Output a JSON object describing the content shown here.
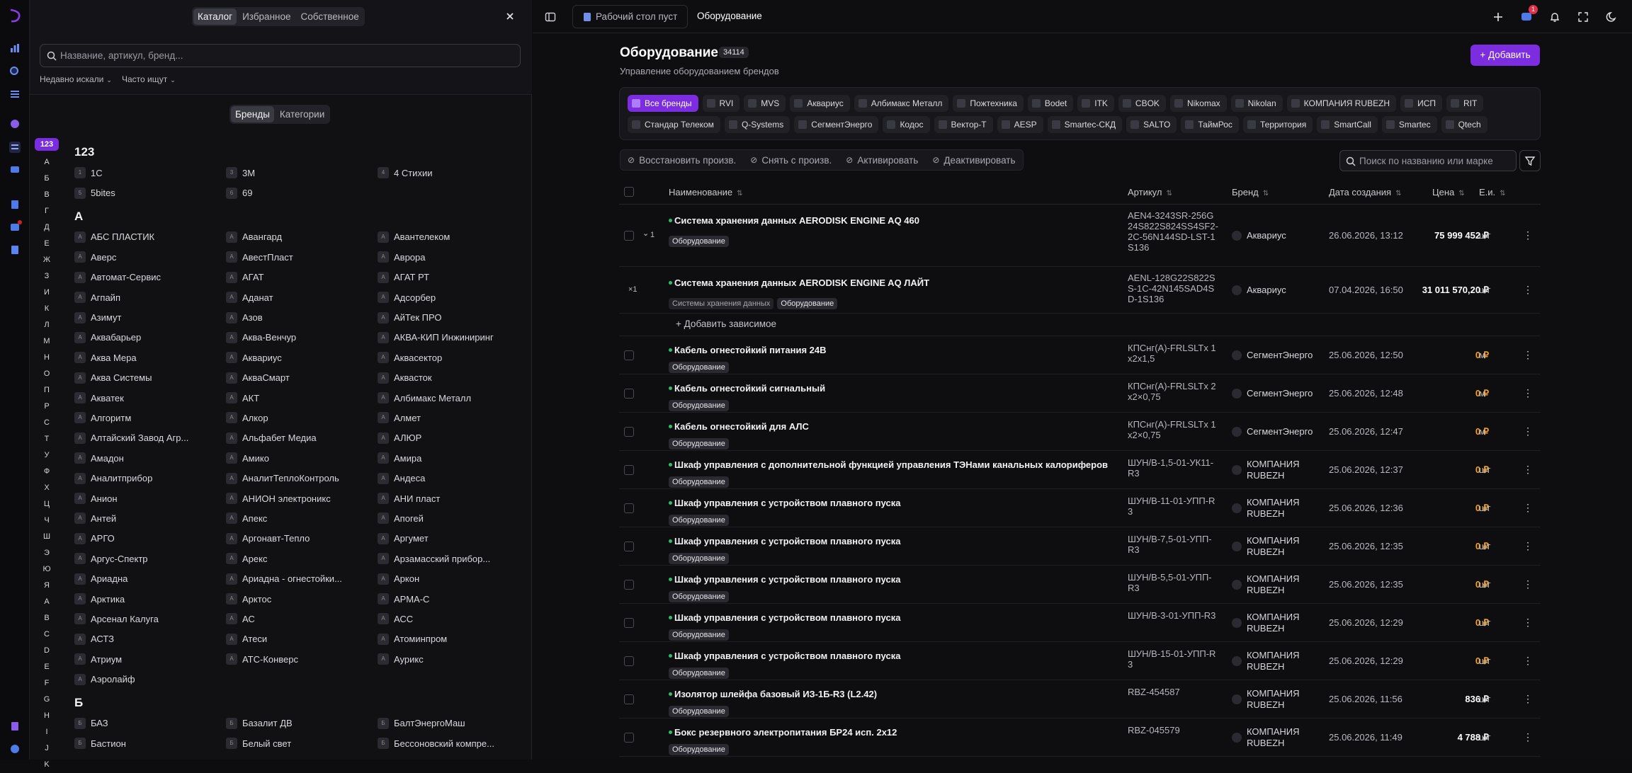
{
  "sidebar": {
    "icons": [
      "logo-icon",
      "analytics-icon",
      "search-icon",
      "list-icon",
      "brand-icon",
      "catalog-icon",
      "chat-icon",
      "book-icon",
      "notifications-icon",
      "document-icon",
      "file-icon",
      "support-icon"
    ]
  },
  "panel": {
    "tabs": [
      "Каталог",
      "Избранное",
      "Собственное"
    ],
    "active_tab": "Каталог",
    "search_placeholder": "Название, артикул, бренд...",
    "recent_label": "Недавно искали",
    "popular_label": "Часто ищут",
    "mode_tabs": [
      "Бренды",
      "Категории"
    ],
    "active_mode": "Бренды",
    "alphabet": [
      "123",
      "А",
      "Б",
      "В",
      "Г",
      "Д",
      "Е",
      "Ж",
      "З",
      "И",
      "К",
      "Л",
      "М",
      "Н",
      "О",
      "П",
      "Р",
      "С",
      "Т",
      "У",
      "Ф",
      "Х",
      "Ц",
      "Ч",
      "Ш",
      "Э",
      "Ю",
      "Я",
      "A",
      "B",
      "C",
      "D",
      "E",
      "F",
      "G",
      "H",
      "I",
      "J",
      "K"
    ],
    "sections": [
      {
        "letter": "123",
        "items": [
          "1C",
          "3M",
          "4 Стихии",
          "5bites",
          "69"
        ]
      },
      {
        "letter": "А",
        "items": [
          "АБС ПЛАСТИК",
          "Авангард",
          "Авантелеком",
          "Аверс",
          "АвестПласт",
          "Аврора",
          "Автомат-Сервис",
          "АГАТ",
          "АГАТ РТ",
          "Агпайп",
          "Аданат",
          "Адсорбер",
          "Азимут",
          "Азов",
          "АйТек ПРО",
          "Аквабарьер",
          "Аква-Венчур",
          "АКВА-КИП Инжиниринг",
          "Аква Мера",
          "Аквариус",
          "Аквасектор",
          "Аква Системы",
          "АкваСмарт",
          "Аквасток",
          "Акватек",
          "АКТ",
          "Албимакс Металл",
          "Алгоритм",
          "Алкор",
          "Алмет",
          "Алтайский Завод Агр...",
          "Альфабет Медиа",
          "АЛЮР",
          "Амадон",
          "Амико",
          "Амира",
          "Аналитприбор",
          "АналитТеплоКонтроль",
          "Андеса",
          "Анион",
          "АНИОН электроникс",
          "АНИ пласт",
          "Антей",
          "Апекс",
          "Апогей",
          "АРГО",
          "Аргонавт-Тепло",
          "Аргумет",
          "Аргус-Спектр",
          "Арекс",
          "Арзамасский прибор...",
          "Ариадна",
          "Ариадна - огнестойки...",
          "Аркон",
          "Арктика",
          "Арктос",
          "АРМА-С",
          "Арсенал Калуга",
          "АС",
          "АСС",
          "АСТЗ",
          "Атеси",
          "Атоминпром",
          "Атриум",
          "АТС-Конверс",
          "Аурикс",
          "Аэролайф"
        ]
      },
      {
        "letter": "Б",
        "items": [
          "БАЗ",
          "Базалит ДВ",
          "БалтЭнергоМаш",
          "Бастион",
          "Белый свет",
          "Бессоновский компре..."
        ]
      }
    ]
  },
  "topbar": {
    "crumb1": "Рабочий стол пуст",
    "crumb2": "Оборудование",
    "notif_count": "1"
  },
  "page": {
    "title": "Оборудование",
    "count": "34114",
    "subtitle": "Управление оборудованием брендов",
    "add_label": "Добавить"
  },
  "brand_chips": [
    "Все бренды",
    "RVI",
    "MVS",
    "Аквариус",
    "Албимакс Металл",
    "Пожтехника",
    "Bodet",
    "ITK",
    "CBOK",
    "Nikomax",
    "Nikolan",
    "КОМПАНИЯ RUBEZH",
    "ИСП",
    "RIT",
    "Стандар Телеком",
    "Q-Systems",
    "СегментЭнерго",
    "Кодос",
    "Вектор-Т",
    "AESP",
    "Smartec-СКД",
    "SALTO",
    "ТаймРос",
    "Территория",
    "SmartCall",
    "Smartec",
    "Qtech"
  ],
  "actions": [
    "Восстановить произв.",
    "Снять с произв.",
    "Активировать",
    "Деактивировать"
  ],
  "table_search_placeholder": "Поиск по названию или марке",
  "columns": [
    "Наименование",
    "Артикул",
    "Бренд",
    "Дата создания",
    "Цена",
    "Е.и."
  ],
  "add_dependent": "Добавить зависимое",
  "rows": [
    {
      "name": "Система хранения данных AERODISK ENGINE AQ 460",
      "tags": [
        "Оборудование"
      ],
      "article": "AEN4-3243SR-256G24S822S824SS4SF2-2C-56N144SD-LST-1S136",
      "brand": "Аквариус",
      "date": "26.06.2026, 13:12",
      "price": "75 999 452 ₽",
      "unit": "шт",
      "level": "1",
      "h": 88
    },
    {
      "name": "Система хранения данных AERODISK ENGINE AQ ЛАЙТ",
      "tags": [
        "Системы хранения данных",
        "Оборудование"
      ],
      "article": "AENL-128G22S822SS-1C-42N145SAD4SD-1S136",
      "brand": "Аквариус",
      "date": "07.04.2026, 16:50",
      "price": "31 011 570,20 ₽",
      "unit": "шт",
      "level": "×1",
      "h": 66
    },
    {
      "name": "Кабель огнестойкий питания 24В",
      "tags": [
        "Оборудование"
      ],
      "article": "КПСнг(А)-FRLSLTx 1x2x1,5",
      "brand": "СегментЭнерго",
      "date": "25.06.2026, 12:50",
      "price": "0 ₽",
      "unit": "м",
      "h": 54
    },
    {
      "name": "Кабель огнестойкий сигнальный",
      "tags": [
        "Оборудование"
      ],
      "article": "КПСнг(А)-FRLSLTx 2x2×0,75",
      "brand": "СегментЭнерго",
      "date": "25.06.2026, 12:48",
      "price": "0 ₽",
      "unit": "м",
      "h": 54
    },
    {
      "name": "Кабель огнестойкий для АЛС",
      "tags": [
        "Оборудование"
      ],
      "article": "КПСнг(А)-FRLSLTx 1x2×0,75",
      "brand": "СегментЭнерго",
      "date": "25.06.2026, 12:47",
      "price": "0 ₽",
      "unit": "м",
      "h": 54
    },
    {
      "name": "Шкаф управления с дополнительной функцией управления ТЭНами канальных калориферов",
      "tags": [
        "Оборудование"
      ],
      "article": "ШУН/В-1,5-01-УК11-R3",
      "brand": "КОМПАНИЯ RUBEZH",
      "date": "25.06.2026, 12:37",
      "price": "0 ₽",
      "unit": "шт",
      "h": 54
    },
    {
      "name": "Шкаф управления с устройством плавного пуска",
      "tags": [
        "Оборудование"
      ],
      "article": "ШУН/В-11-01-УПП-R3",
      "brand": "КОМПАНИЯ RUBEZH",
      "date": "25.06.2026, 12:36",
      "price": "0 ₽",
      "unit": "шт",
      "h": 54
    },
    {
      "name": "Шкаф управления с устройством плавного пуска",
      "tags": [
        "Оборудование"
      ],
      "article": "ШУН/В-7,5-01-УПП-R3",
      "brand": "КОМПАНИЯ RUBEZH",
      "date": "25.06.2026, 12:35",
      "price": "0 ₽",
      "unit": "шт",
      "h": 54
    },
    {
      "name": "Шкаф управления с устройством плавного пуска",
      "tags": [
        "Оборудование"
      ],
      "article": "ШУН/В-5,5-01-УПП-R3",
      "brand": "КОМПАНИЯ RUBEZH",
      "date": "25.06.2026, 12:35",
      "price": "0 ₽",
      "unit": "шт",
      "h": 54
    },
    {
      "name": "Шкаф управления с устройством плавного пуска",
      "tags": [
        "Оборудование"
      ],
      "article": "ШУН/В-3-01-УПП-R3",
      "brand": "КОМПАНИЯ RUBEZH",
      "date": "25.06.2026, 12:29",
      "price": "0 ₽",
      "unit": "шт",
      "h": 54
    },
    {
      "name": "Шкаф управления с устройством плавного пуска",
      "tags": [
        "Оборудование"
      ],
      "article": "ШУН/В-15-01-УПП-R3",
      "brand": "КОМПАНИЯ RUBEZH",
      "date": "25.06.2026, 12:29",
      "price": "0 ₽",
      "unit": "шт",
      "h": 54
    },
    {
      "name": "Изолятор шлейфа базовый ИЗ-1Б-R3 (L2.42)",
      "tags": [
        "Оборудование"
      ],
      "article": "RBZ-454587",
      "brand": "КОМПАНИЯ RUBEZH",
      "date": "25.06.2026, 11:56",
      "price": "836 ₽",
      "unit": "шт",
      "h": 54
    },
    {
      "name": "Бокс резервного электропитания БР24 исп. 2x12",
      "tags": [
        "Оборудование"
      ],
      "article": "RBZ-045579",
      "brand": "КОМПАНИЯ RUBEZH",
      "date": "25.06.2026, 11:49",
      "price": "4 788 ₽",
      "unit": "шт",
      "h": 54
    }
  ]
}
